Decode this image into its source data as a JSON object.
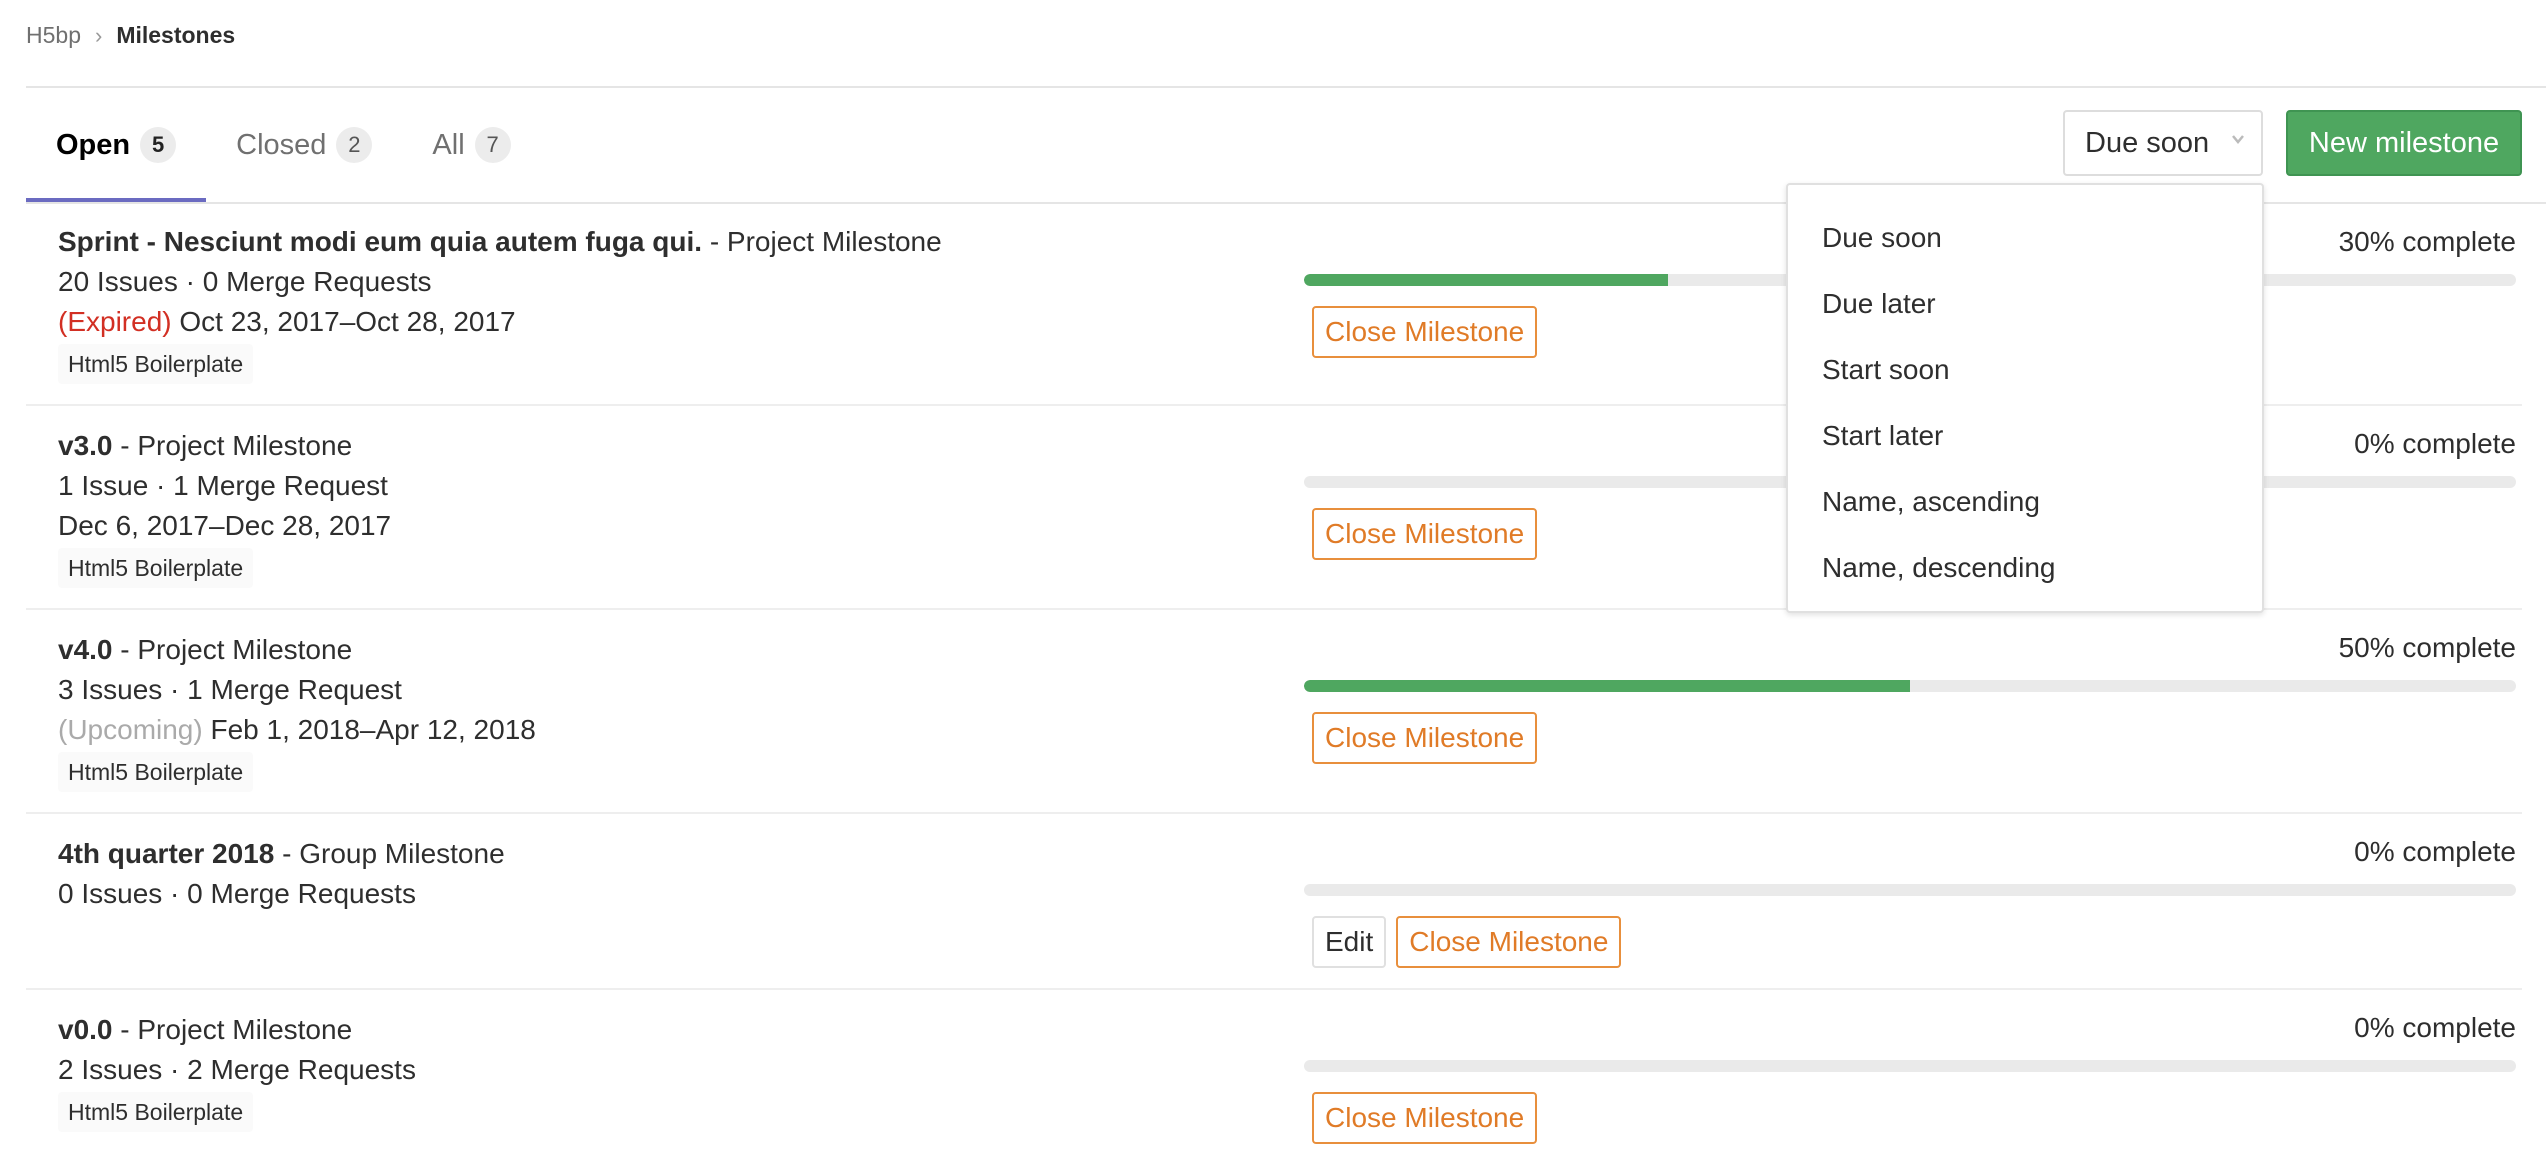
{
  "breadcrumb": {
    "parent": "H5bp",
    "separator": "›",
    "current": "Milestones"
  },
  "tabs": [
    {
      "label": "Open",
      "count": "5",
      "active": true
    },
    {
      "label": "Closed",
      "count": "2",
      "active": false
    },
    {
      "label": "All",
      "count": "7",
      "active": false
    }
  ],
  "sort": {
    "selected": "Due soon",
    "icon": "chevron-down-icon"
  },
  "new_milestone_label": "New milestone",
  "dropdown": {
    "options": [
      "Due soon",
      "Due later",
      "Start soon",
      "Start later",
      "Name, ascending",
      "Name, descending"
    ]
  },
  "colors": {
    "accent": "#6b6bc1",
    "success": "#4fa760",
    "warning": "#e07b27",
    "expired": "#d22f23"
  },
  "milestones": [
    {
      "title": "Sprint - Nesciunt modi eum quia autem fuga qui.",
      "type": " - Project Milestone",
      "counts": "20 Issues · 0 Merge Requests",
      "status": "(Expired)",
      "dates": " Oct 23, 2017–Oct 28, 2017",
      "project": "Html5 Boilerplate",
      "progress_percent": 30,
      "progress_label": "30% complete",
      "close_label": "Close Milestone"
    },
    {
      "title": "v3.0",
      "type": " - Project Milestone",
      "counts": "1 Issue · 1 Merge Request",
      "status": "",
      "dates": "Dec 6, 2017–Dec 28, 2017",
      "project": "Html5 Boilerplate",
      "progress_percent": 0,
      "progress_label": "0% complete",
      "close_label": "Close Milestone"
    },
    {
      "title": "v4.0",
      "type": " - Project Milestone",
      "counts": "3 Issues · 1 Merge Request",
      "status": "(Upcoming)",
      "dates": " Feb 1, 2018–Apr 12, 2018",
      "project": "Html5 Boilerplate",
      "progress_percent": 50,
      "progress_label": "50% complete",
      "close_label": "Close Milestone"
    },
    {
      "title": "4th quarter 2018",
      "type": " - Group Milestone",
      "counts": "0 Issues · 0 Merge Requests",
      "progress_percent": 0,
      "progress_label": "0% complete",
      "edit_label": "Edit",
      "close_label": "Close Milestone"
    },
    {
      "title": "v0.0",
      "type": " - Project Milestone",
      "counts": "2 Issues · 2 Merge Requests",
      "project": "Html5 Boilerplate",
      "progress_percent": 0,
      "progress_label": "0% complete",
      "close_label": "Close Milestone"
    }
  ]
}
